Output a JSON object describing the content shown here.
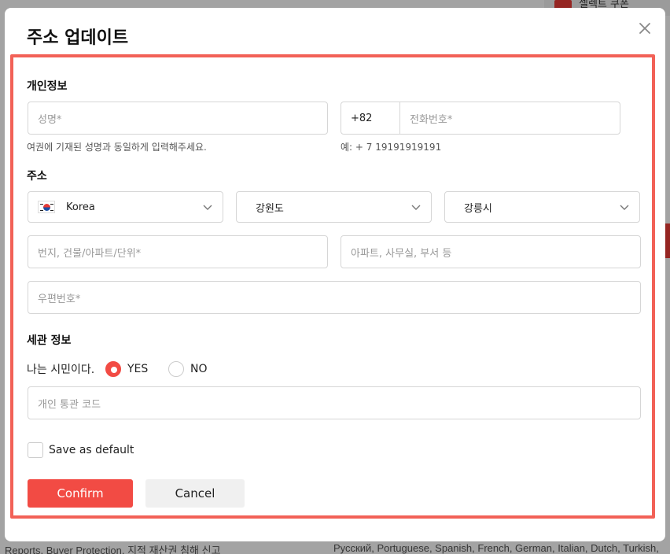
{
  "background": {
    "top_right_text": "셀렉트 쿠폰",
    "footer_left": "Reports, Buyer Protection, 지적 재산권 침해 신고",
    "footer_right": "Русский, Portuguese, Spanish, French, German, Italian, Dutch, Turkish,"
  },
  "modal": {
    "title": "주소 업데이트",
    "close_icon": "close-icon"
  },
  "personal": {
    "section_label": "개인정보",
    "name_placeholder": "성명*",
    "name_hint": "여권에 기재된 성명과 동일하게 입력해주세요.",
    "phone_code": "+82",
    "phone_placeholder": "전화번호*",
    "phone_hint": "예: + 7 19191919191"
  },
  "address": {
    "section_label": "주소",
    "country": "Korea",
    "province": "강원도",
    "city": "강릉시",
    "street_placeholder": "번지, 건물/아파트/단위*",
    "apt_placeholder": "아파트, 사무실, 부서 등",
    "postal_placeholder": "우편번호*"
  },
  "customs": {
    "section_label": "세관 정보",
    "citizen_question": "나는 시민이다.",
    "yes_label": "YES",
    "no_label": "NO",
    "selected": "YES",
    "customs_code_placeholder": "개인 통관 코드"
  },
  "default": {
    "label": "Save as default",
    "checked": false
  },
  "buttons": {
    "confirm": "Confirm",
    "cancel": "Cancel"
  },
  "colors": {
    "accent": "#f24b44",
    "highlight_border": "#f26157"
  }
}
